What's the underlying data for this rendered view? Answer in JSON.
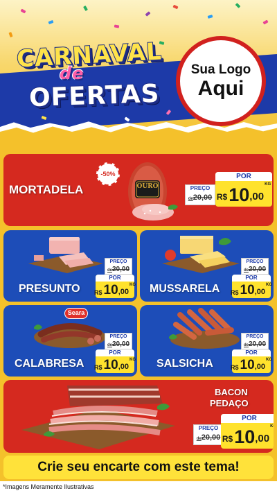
{
  "header": {
    "title_line1": "CARNAVAL",
    "title_line2": "de",
    "title_line3": "OFERTAS",
    "logo_line1": "Sua Logo",
    "logo_line2": "Aqui"
  },
  "products": {
    "mortadela": {
      "name": "MORTADELA",
      "discount": "-50%",
      "brand": "OURO",
      "preco_label": "PREÇO",
      "old_prefix": "de",
      "old_price": "20,00",
      "por_label": "POR",
      "currency": "R$",
      "price_int": "10",
      "price_cents": ",00",
      "unit": "KG"
    },
    "presunto": {
      "name": "PRESUNTO",
      "preco_label": "PREÇO",
      "old_prefix": "de",
      "old_price": "20,00",
      "por_label": "POR",
      "currency": "R$",
      "price_int": "10",
      "price_cents": ",00",
      "unit": "KG"
    },
    "mussarela": {
      "name": "MUSSARELA",
      "preco_label": "PREÇO",
      "old_prefix": "de",
      "old_price": "20,00",
      "por_label": "POR",
      "currency": "R$",
      "price_int": "10",
      "price_cents": ",00",
      "unit": "KG"
    },
    "calabresa": {
      "name": "CALABRESA",
      "brand": "Seara",
      "preco_label": "PREÇO",
      "old_prefix": "de",
      "old_price": "20,00",
      "por_label": "POR",
      "currency": "R$",
      "price_int": "10",
      "price_cents": ",00",
      "unit": "KG"
    },
    "salsicha": {
      "name": "SALSICHA",
      "preco_label": "PREÇO",
      "old_prefix": "de",
      "old_price": "20,00",
      "por_label": "POR",
      "currency": "R$",
      "price_int": "10",
      "price_cents": ",00",
      "unit": "KG"
    },
    "bacon": {
      "name_line1": "BACON",
      "name_line2": "PEDAÇO",
      "preco_label": "PREÇO",
      "old_prefix": "de",
      "old_price": "20,00",
      "por_label": "POR",
      "currency": "R$",
      "price_int": "10",
      "price_cents": ",00",
      "unit": "KG"
    }
  },
  "footer": {
    "cta": "Crie seu encarte com este tema!",
    "disclaimer": "*Imagens Meramente Ilustrativas"
  },
  "colors": {
    "red_panel": "#d5291f",
    "blue_panel": "#1d4db8",
    "yellow": "#f4c12b",
    "price_yellow": "#ffe22d"
  }
}
